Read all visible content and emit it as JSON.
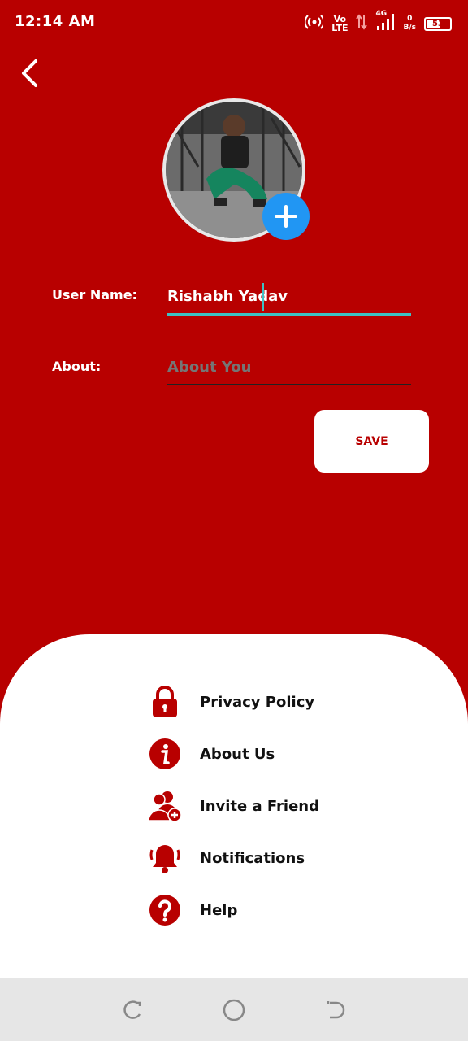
{
  "status_bar": {
    "time": "12:14 AM",
    "net_top": "Vo",
    "net_bottom": "LTE",
    "network_type": "4G",
    "speed_top": "0",
    "speed_bottom": "B/s",
    "battery": "53"
  },
  "profile": {
    "username_label": "User Name:",
    "username_value": "Rishabh Yadav",
    "about_label": "About:",
    "about_placeholder": "About You",
    "save_label": "SAVE"
  },
  "menu": {
    "items": [
      {
        "label": "Privacy Policy",
        "icon": "lock-icon"
      },
      {
        "label": "About Us",
        "icon": "info-icon"
      },
      {
        "label": "Invite a Friend",
        "icon": "add-user-icon"
      },
      {
        "label": "Notifications",
        "icon": "bell-icon"
      },
      {
        "label": "Help",
        "icon": "question-icon"
      }
    ]
  },
  "colors": {
    "primary": "#b80000",
    "accent": "#3ec1c4",
    "fab": "#2196f3",
    "sheet": "#ffffff"
  }
}
